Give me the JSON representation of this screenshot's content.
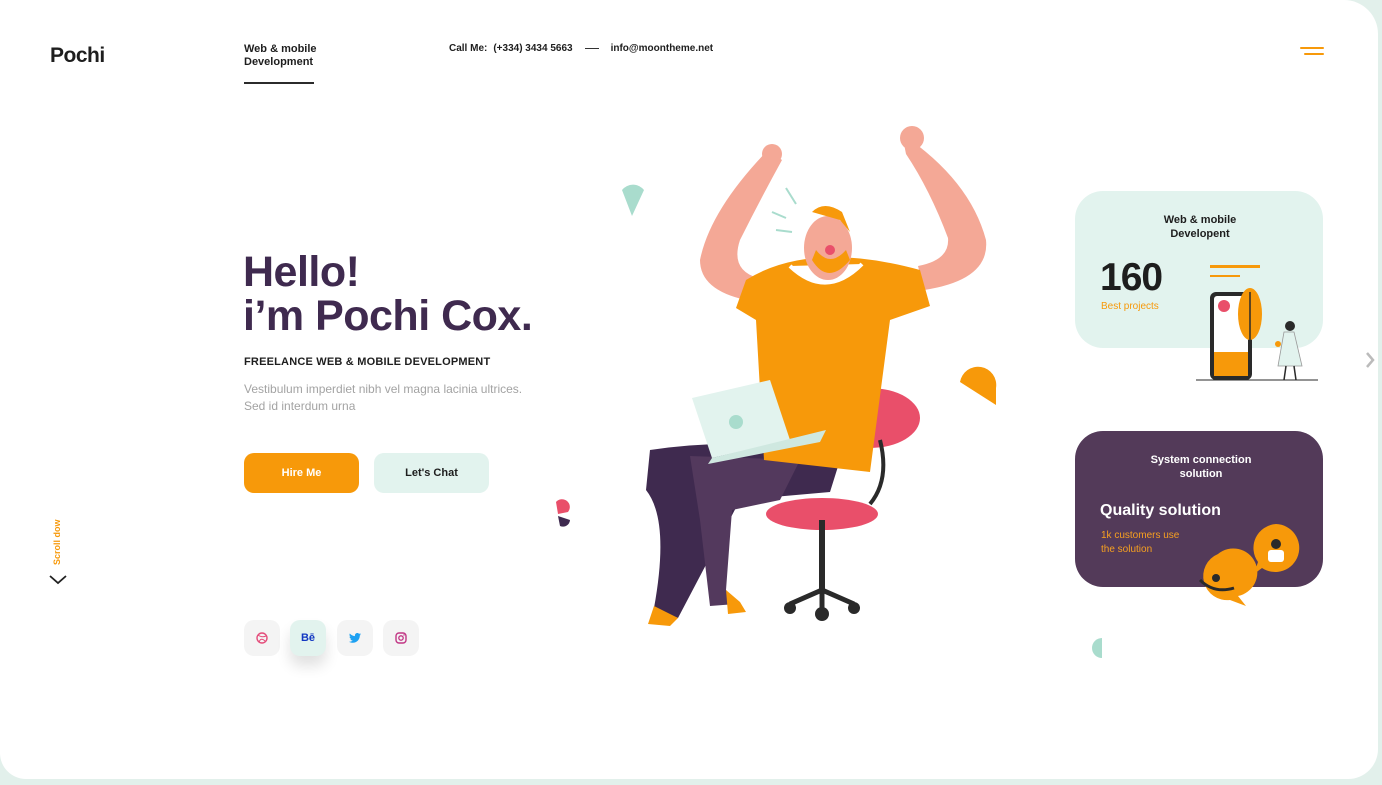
{
  "brand": {
    "name_prefix": "Poch",
    "name_suffix": "i"
  },
  "nav": {
    "link_line1": "Web & mobile",
    "link_line2": "Development"
  },
  "contact": {
    "call_label": "Call Me:",
    "phone": "(+334) 3434 5663",
    "email": "info@moontheme.net"
  },
  "hero": {
    "title_line1": "Hello!",
    "title_line2": "i’m Pochi Cox.",
    "subtitle": "FREELANCE WEB & MOBILE DEVELOPMENT",
    "desc_line1": "Vestibulum imperdiet nibh vel magna lacinia ultrices.",
    "desc_line2": "Sed id interdum urna",
    "hire_label": "Hire Me",
    "chat_label": "Let's Chat"
  },
  "social": [
    {
      "name": "dribbble-icon",
      "glyph": "◎"
    },
    {
      "name": "behance-icon",
      "glyph": "Bē"
    },
    {
      "name": "twitter-icon",
      "glyph": "🐦"
    },
    {
      "name": "instagram-icon",
      "glyph": "◘"
    }
  ],
  "scroll": {
    "label": "Scroll dow"
  },
  "card_projects": {
    "title_line1": "Web & mobile",
    "title_line2": "Developent",
    "count": "160",
    "label": "Best projects"
  },
  "card_quality": {
    "title_line1": "System connection",
    "title_line2": "solution",
    "heading": "Quality solution",
    "sub_line1": "1k customers use",
    "sub_line2": "the solution"
  },
  "colors": {
    "accent": "#f7990a",
    "dark_purple": "#3f2a4f",
    "mint": "#e2f3ee",
    "card_purple": "#533a59"
  }
}
